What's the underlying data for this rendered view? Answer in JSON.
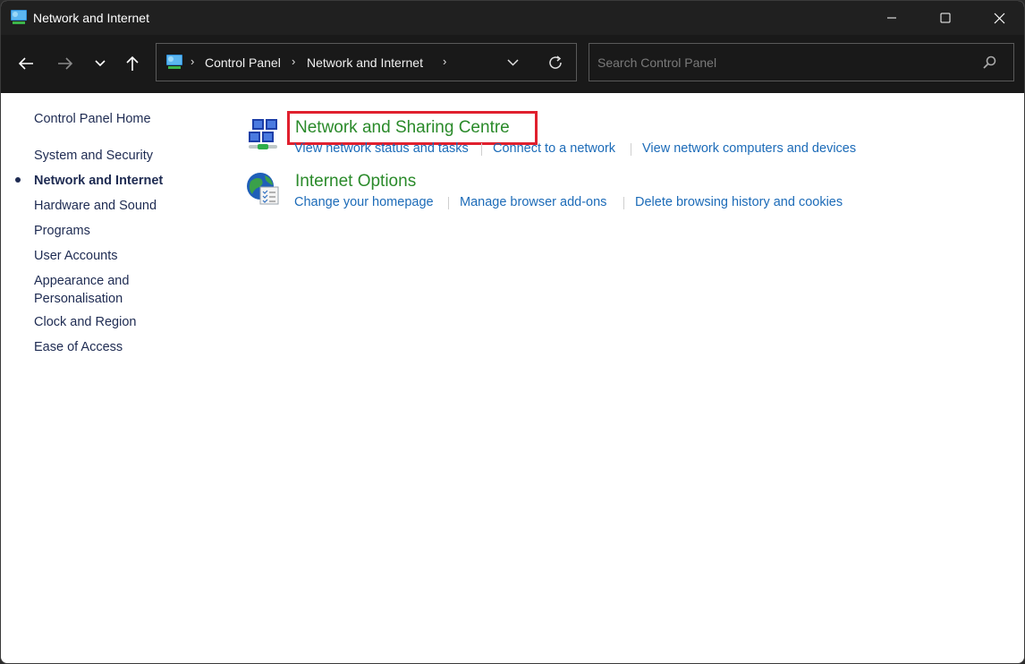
{
  "window": {
    "title": "Network and Internet",
    "app_icon": "control-panel-network-icon",
    "controls": {
      "minimize": "minimize-icon",
      "maximize": "maximize-icon",
      "close": "close-icon"
    }
  },
  "navigation": {
    "back": "arrow-left-icon",
    "forward": "arrow-right-icon",
    "recent": "chevron-down-icon",
    "up": "arrow-up-icon"
  },
  "address_bar": {
    "breadcrumbs": [
      "Control Panel",
      "Network and Internet"
    ],
    "separator": "›",
    "dropdown_icon": "chevron-down-icon",
    "refresh_icon": "refresh-icon"
  },
  "search": {
    "placeholder": "Search Control Panel",
    "value": "",
    "icon": "search-icon"
  },
  "sidebar": {
    "home_link": "Control Panel Home",
    "items": [
      {
        "label": "System and Security",
        "active": false
      },
      {
        "label": "Network and Internet",
        "active": true
      },
      {
        "label": "Hardware and Sound",
        "active": false
      },
      {
        "label": "Programs",
        "active": false
      },
      {
        "label": "User Accounts",
        "active": false
      },
      {
        "label": "Appearance and Personalisation",
        "active": false
      },
      {
        "label": "Clock and Region",
        "active": false
      },
      {
        "label": "Ease of Access",
        "active": false
      }
    ]
  },
  "categories": [
    {
      "title": "Network and Sharing Centre",
      "icon": "network-sharing-icon",
      "highlighted": true,
      "tasks": [
        "View network status and tasks",
        "Connect to a network",
        "View network computers and devices"
      ]
    },
    {
      "title": "Internet Options",
      "icon": "internet-options-icon",
      "highlighted": false,
      "tasks": [
        "Change your homepage",
        "Manage browser add-ons",
        "Delete browsing history and cookies"
      ]
    }
  ],
  "colors": {
    "title_bar": "#202020",
    "nav_bar": "#191919",
    "category_title": "#2a8a2a",
    "task_link": "#1c6bb8",
    "sidebar_text": "#1e2b52",
    "highlight_box": "#e0202e"
  }
}
